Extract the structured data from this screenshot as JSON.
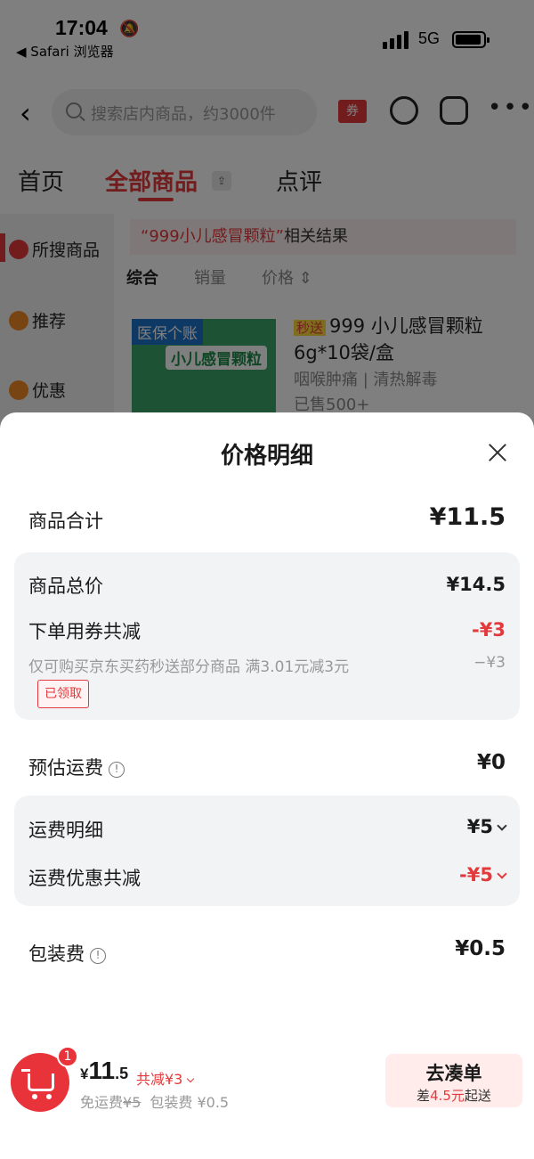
{
  "status": {
    "time": "17:04",
    "back_app": "◀ Safari 浏览器",
    "network": "5G"
  },
  "nav": {
    "search_placeholder": "搜索店内商品，约3000件",
    "coupon": "券"
  },
  "tabs": [
    {
      "label": "首页"
    },
    {
      "label": "全部商品"
    },
    {
      "label": "点评"
    }
  ],
  "leftnav": [
    {
      "label": "所搜商品"
    },
    {
      "label": "推荐"
    },
    {
      "label": "优惠"
    }
  ],
  "results": {
    "keyword": "“999小儿感冒颗粒”",
    "suffix": "相关结果",
    "sorts": [
      "综合",
      "销量",
      "价格 ⇕"
    ]
  },
  "product": {
    "badge": "医保个账",
    "image_title": "小儿感冒颗粒",
    "tag": "秒送",
    "title": "999 小儿感冒颗粒 6g*10袋/盒",
    "sub": "咽喉肿痛 | 清热解毒",
    "sold": "已售500+"
  },
  "sheet": {
    "title": "价格明细",
    "goods_total_label": "商品合计",
    "goods_total_value": "¥11.5",
    "goods_price_label": "商品总价",
    "goods_price_value": "¥14.5",
    "coupon_label": "下单用券共减",
    "coupon_value": "-¥3",
    "coupon_desc": "仅可购买京东买药秒送部分商品 满3.01元减3元",
    "coupon_desc_value": "−¥3",
    "coupon_tag": "已领取",
    "ship_label": "预估运费",
    "ship_value": "¥0",
    "ship_detail_label": "运费明细",
    "ship_detail_value": "¥5",
    "ship_discount_label": "运费优惠共减",
    "ship_discount_value": "-¥5",
    "pack_label": "包装费",
    "pack_value": "¥0.5"
  },
  "bottom": {
    "cart_count": "1",
    "currency": "¥",
    "total_int": "11",
    "total_dec": ".5",
    "saved": "共减¥3",
    "free_ship": "免运费",
    "orig_ship": "¥5",
    "pack": "包装费 ¥0.5",
    "btn_label": "去凑单",
    "btn_sub_pre": "差",
    "btn_sub_amt": "4.5元",
    "btn_sub_post": "起送"
  },
  "colors": {
    "accent": "#e4393c",
    "sheet_bg": "#ffffff",
    "box_bg": "#f2f3f5"
  }
}
